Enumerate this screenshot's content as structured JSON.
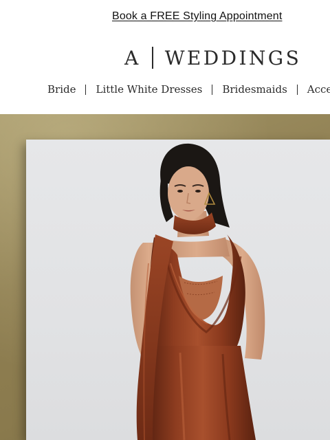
{
  "banner": {
    "link_text": "Book a FREE Styling Appointment"
  },
  "logo": {
    "mark": "A",
    "word": "WEDDINGS"
  },
  "nav": {
    "items": [
      {
        "label": "Bride"
      },
      {
        "label": "Little White Dresses"
      },
      {
        "label": "Bridesmaids"
      },
      {
        "label": "Acces"
      }
    ]
  },
  "hero": {
    "image": "model-in-rust-satin-halter-gown",
    "colors": {
      "frame": "#8f7f52",
      "backdrop": "#e3e4e6",
      "dress": "#8a3a1f"
    }
  }
}
